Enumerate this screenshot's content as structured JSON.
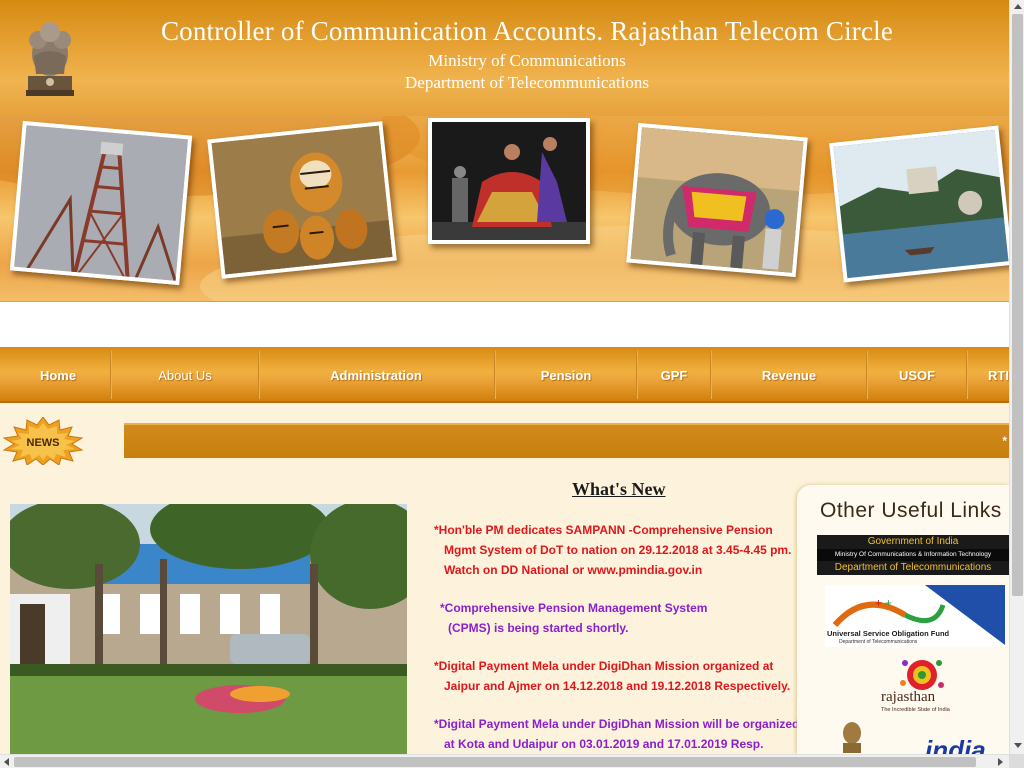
{
  "header": {
    "title": "Controller of Communication Accounts. Rajasthan Telecom Circle",
    "subtitle1": "Ministry of Communications",
    "subtitle2": "Department of Telecommunications"
  },
  "nav": {
    "items": [
      {
        "label": "Home"
      },
      {
        "label": "About Us"
      },
      {
        "label": "Administration"
      },
      {
        "label": "Pension"
      },
      {
        "label": "GPF"
      },
      {
        "label": "Revenue"
      },
      {
        "label": "USOF"
      },
      {
        "label": "RTI"
      }
    ]
  },
  "news_bar": {
    "badge": "NEWS",
    "ticker": "*"
  },
  "whats_new": {
    "title": "What's New",
    "items": [
      {
        "lines": [
          "*Hon'ble PM dedicates SAMPANN -Comprehensive Pension",
          "Mgmt System of DoT to nation on 29.12.2018 at 3.45-4.45 pm.",
          "Watch on DD National or www.pmindia.gov.in"
        ],
        "color": "#e0161b"
      },
      {
        "lines": [
          "*Comprehensive Pension Management System",
          "(CPMS) is being started shortly."
        ],
        "color": "#8a1ed0"
      },
      {
        "lines": [
          "*Digital Payment Mela under DigiDhan Mission organized at",
          "Jaipur and Ajmer on 14.12.2018 and 19.12.2018 Respectively."
        ],
        "color": "#e0161b"
      },
      {
        "lines": [
          "*Digital Payment Mela under DigiDhan Mission will be organized",
          "at Kota and Udaipur on 03.01.2019 and 17.01.2019 Resp."
        ],
        "color": "#8a1ed0"
      }
    ]
  },
  "links_panel": {
    "title": "Other Useful Links",
    "dot_logo": {
      "line1": "Government of India",
      "line2": "Ministry Of Communications & Information Technology",
      "line3": "Department of Telecommunications"
    },
    "usof_logo": {
      "line1": "Universal Service Obligation Fund",
      "line2": "Department of Telecommunications"
    },
    "rajasthan_logo": {
      "name": "rajasthan",
      "tagline": "The Incredible State of India"
    },
    "india_logo": {
      "text": "india"
    }
  },
  "colors": {
    "header": "#e39a2a",
    "nav": "#e9a536",
    "news_bar": "#cb840f",
    "red_text": "#e0161b",
    "purple_text": "#8a1ed0"
  }
}
